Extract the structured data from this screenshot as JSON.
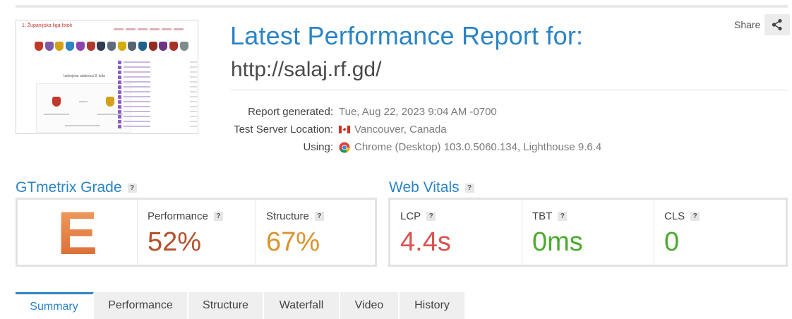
{
  "thumbnail": {
    "title": "1. Županijska liga Istok",
    "standings_label": "Izdvojena utakmica 8. kola"
  },
  "header": {
    "title": "Latest Performance Report for:",
    "url": "http://salaj.rf.gd/",
    "share_label": "Share"
  },
  "meta": {
    "report_generated_label": "Report generated:",
    "report_generated_value": "Tue, Aug 22, 2023 9:04 AM -0700",
    "location_label": "Test Server Location:",
    "location_value": "Vancouver, Canada",
    "using_label": "Using:",
    "using_value": "Chrome (Desktop) 103.0.5060.134, Lighthouse 9.6.4"
  },
  "grade": {
    "section_title": "GTmetrix Grade",
    "letter": "E",
    "performance_label": "Performance",
    "performance_value": "52%",
    "structure_label": "Structure",
    "structure_value": "67%"
  },
  "vitals": {
    "section_title": "Web Vitals",
    "lcp_label": "LCP",
    "lcp_value": "4.4s",
    "tbt_label": "TBT",
    "tbt_value": "0ms",
    "cls_label": "CLS",
    "cls_value": "0"
  },
  "help_glyph": "?",
  "tabs": [
    {
      "label": "Summary",
      "active": true
    },
    {
      "label": "Performance",
      "active": false
    },
    {
      "label": "Structure",
      "active": false
    },
    {
      "label": "Waterfall",
      "active": false
    },
    {
      "label": "Video",
      "active": false
    },
    {
      "label": "History",
      "active": false
    }
  ],
  "colors": {
    "brand_blue": "#2b84c6",
    "grade_e": "#e07a3c",
    "performance": "#b5502c",
    "structure": "#d9932e",
    "lcp": "#d9534f",
    "good": "#4caa2f"
  }
}
